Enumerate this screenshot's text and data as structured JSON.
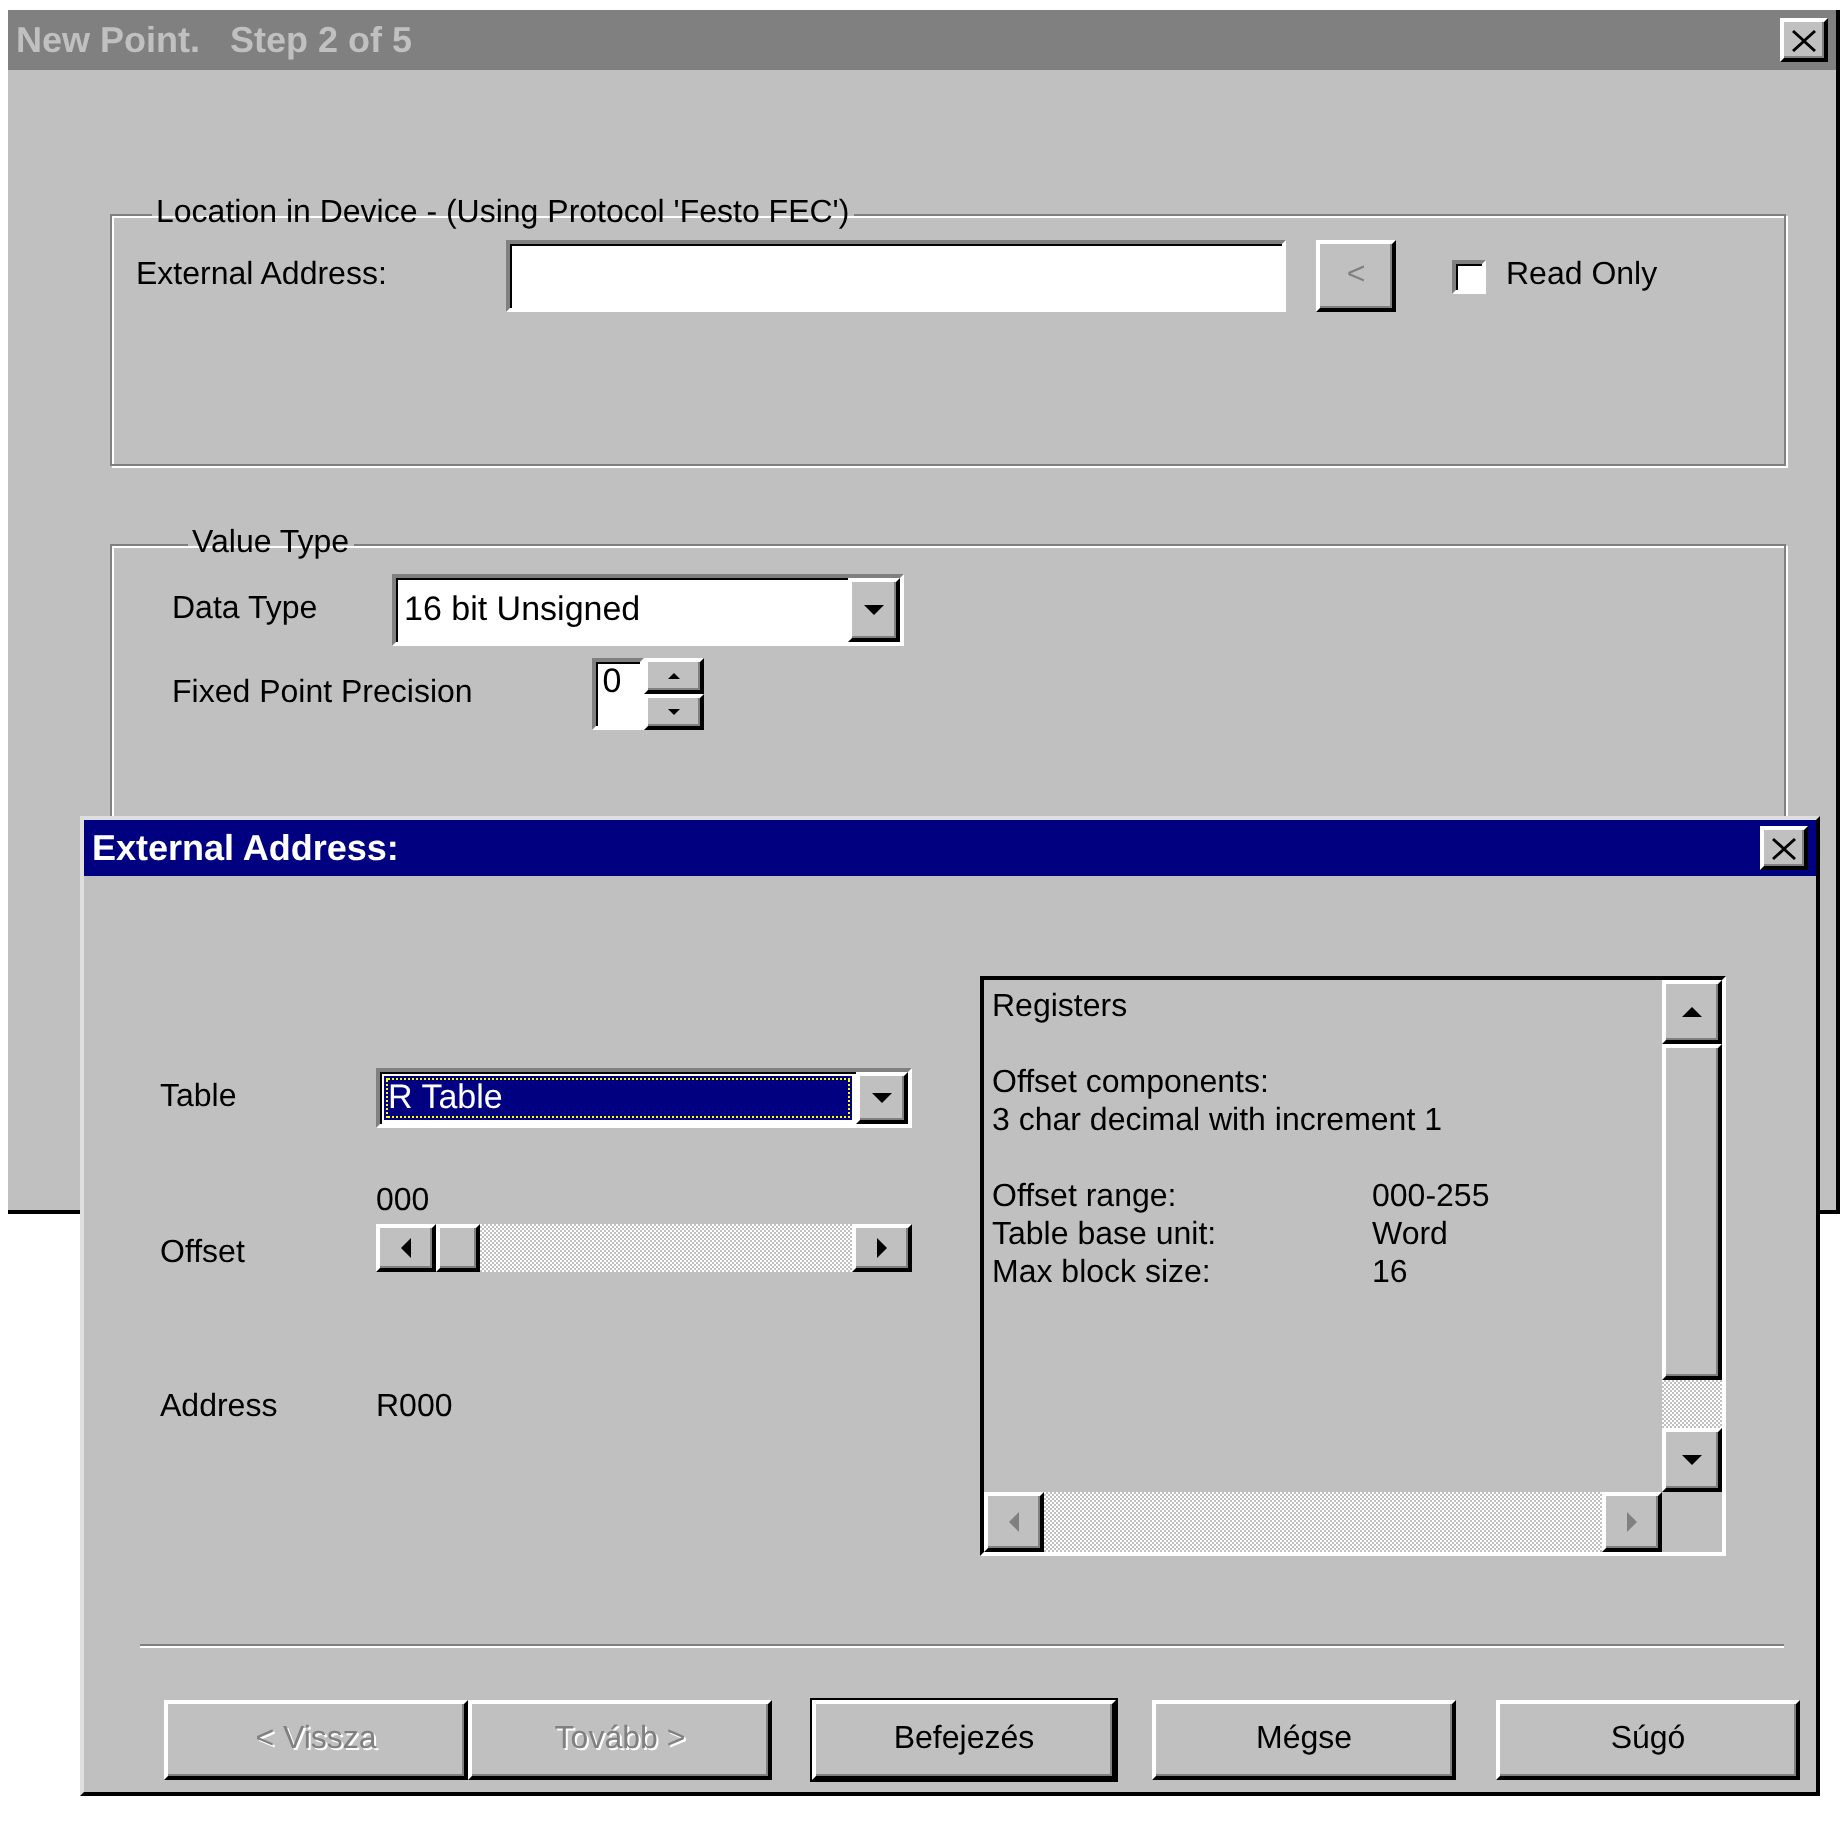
{
  "back_window": {
    "title": "New Point.   Step 2 of 5",
    "location_group": {
      "legend": "Location in Device - (Using Protocol 'Festo FEC')",
      "address_label": "External Address:",
      "browse_button": "<",
      "read_only": {
        "label": "Read Only",
        "checked": false
      }
    },
    "value_type_group": {
      "legend": "Value Type",
      "data_type": {
        "label": "Data Type",
        "value": "16 bit Unsigned"
      },
      "precision": {
        "label": "Fixed Point Precision",
        "value": "0"
      }
    }
  },
  "dialog": {
    "title": "External Address:",
    "table": {
      "label": "Table",
      "value": "R Table"
    },
    "offset": {
      "label": "Offset",
      "reading": "000",
      "level": 0
    },
    "address": {
      "label": "Address",
      "value": "R000"
    },
    "info": {
      "heading": "Registers",
      "components_label": "Offset components:",
      "components_value": "3 char decimal with increment 1",
      "details": [
        {
          "label": "Offset range:",
          "value": "000-255"
        },
        {
          "label": "Table base unit:",
          "value": "Word"
        },
        {
          "label": "Max block size:",
          "value": "16"
        }
      ]
    },
    "buttons": [
      {
        "label": "< Vissza",
        "disabled": true,
        "default": false
      },
      {
        "label": "Tovább >",
        "disabled": true,
        "default": false
      },
      {
        "label": "Befejezés",
        "disabled": false,
        "default": true
      },
      {
        "label": "Mégse",
        "disabled": false,
        "default": false
      },
      {
        "label": "Súgó",
        "disabled": false,
        "default": false
      }
    ]
  }
}
